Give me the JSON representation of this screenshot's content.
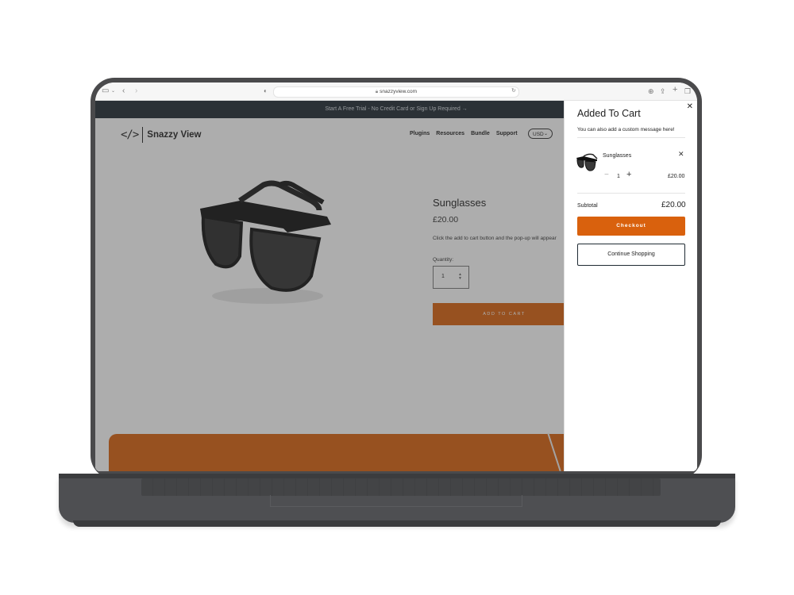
{
  "browser": {
    "url": "snazzyview.com",
    "icons": {
      "sidebar": "sidebar-icon",
      "back": "chevron-left-icon",
      "forward": "chevron-right-icon",
      "privacy": "shield-icon",
      "reload": "reload-icon",
      "download": "download-icon",
      "share": "share-icon",
      "new_tab": "plus-icon",
      "tabs": "tabs-icon"
    }
  },
  "site": {
    "announcement": "Start A Free Trial - No Credit Card or Sign Up Required →",
    "logo": {
      "code": "</>",
      "text": "Snazzy View"
    },
    "nav": [
      "Plugins",
      "Resources",
      "Bundle",
      "Support"
    ],
    "currency": "USD",
    "product": {
      "title": "Sunglasses",
      "price": "£20.00",
      "description": "Click the add to cart button and the pop-up will appear",
      "quantity_label": "Quantity:",
      "quantity_value": "1",
      "add_to_cart": "ADD TO CART"
    }
  },
  "cart": {
    "title": "Added To Cart",
    "message": "You can also add a custom message here!",
    "item": {
      "name": "Sunglasses",
      "quantity": "1",
      "price": "£20.00"
    },
    "subtotal_label": "Subtotal",
    "subtotal_value": "£20.00",
    "checkout_label": "Checkout",
    "continue_label": "Continue Shopping"
  },
  "colors": {
    "accent": "#d9610d",
    "announcement_bg": "#1f2a33",
    "laptop": "#4a4a4c"
  }
}
